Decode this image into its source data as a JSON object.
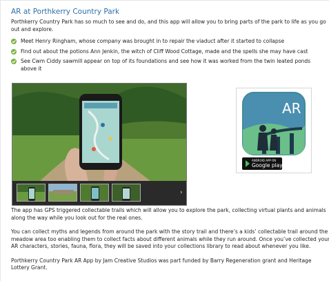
{
  "page": {
    "title": "AR at Porthkerry Country Park",
    "intro": [
      "Porthkerry Country Park has so much to see and do, and this app will allow you to bring parts of the park to life as you go",
      "out and explore."
    ],
    "bullets": [
      [
        "Meet Henry Ringham, whose company was brought in to repair the viaduct after it started to collapse"
      ],
      [
        "Find out about the potions Ann Jenkin, the witch of Cliff Wood Cottage,  made and the spells she may have cast"
      ],
      [
        "See Cwm Ciddy sawmill appear on top of its foundations and see how it was worked from the twin leated ponds",
        "above it"
      ]
    ],
    "app_icon": {
      "label": "AR",
      "badge_small": "ANDROID APP ON",
      "badge_large": "Google play"
    },
    "gallery": {
      "next_arrow": "›"
    },
    "paragraphs": [
      [
        "The app has GPS triggered collectable trails which will allow you to explore the park, collecting virtual plants and animals",
        "along the way while you look out for the real ones."
      ],
      [
        "You can collect myths and legends from around the park with the story trail and there’s a kids’ collectable trail around the",
        "meadow area too enabling them to collect facts about different animals while they run around. Once you’ve collected your",
        "AR characters, stories, fauna, flora, they will be saved into your collections library to read about whenever you like."
      ],
      [
        "Porthkerry Country Park AR App by Jam Creative Studios was part funded by Barry Regeneration grant and Heritage",
        "Lottery Grant."
      ]
    ],
    "colors": {
      "title": "#2e6fa7",
      "check": "#7bb344",
      "icon_bg": "#4a8fb0",
      "icon_frame": "#3f8a9a"
    }
  }
}
